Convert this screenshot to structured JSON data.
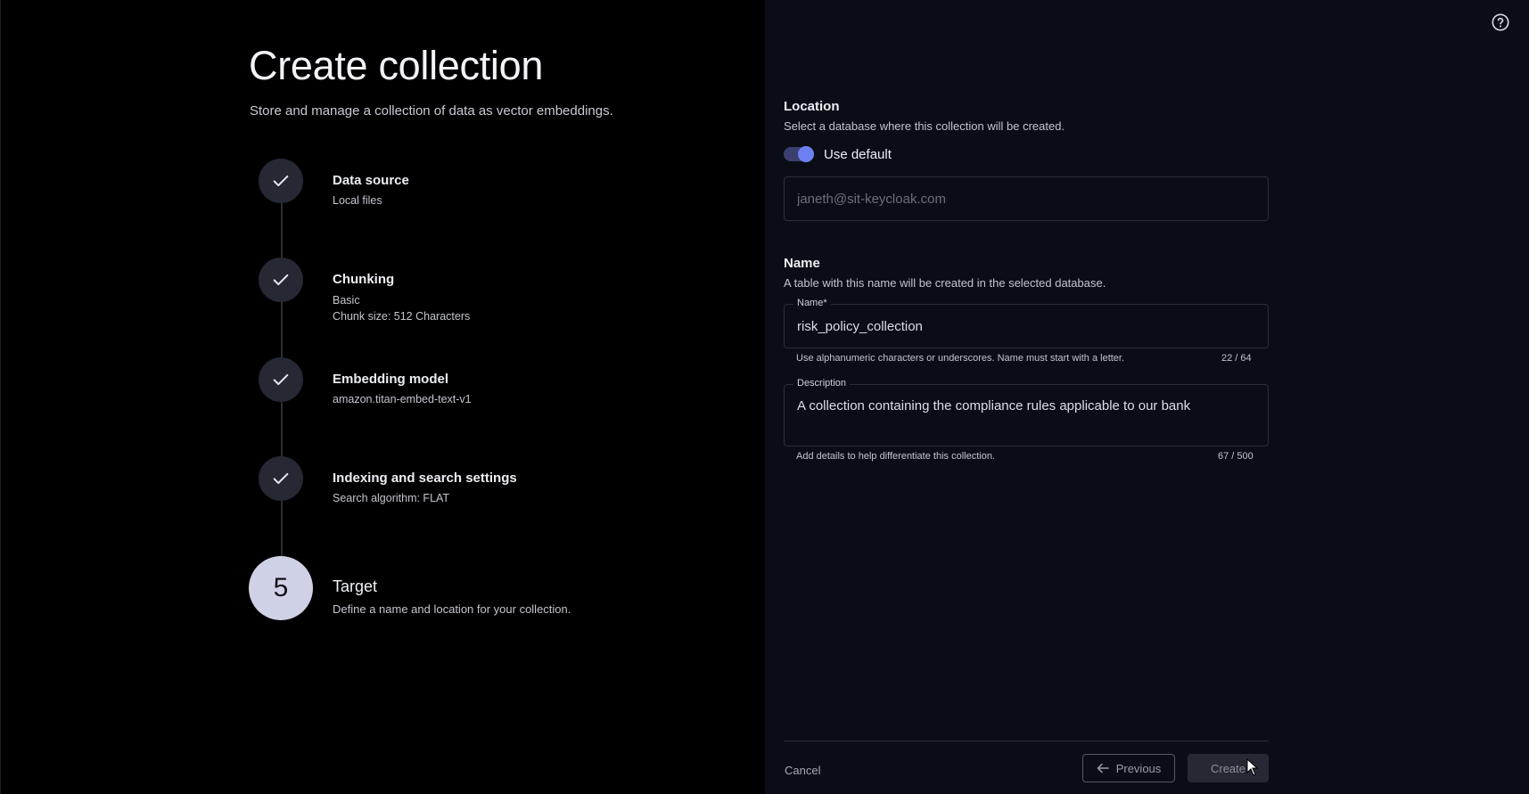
{
  "header": {
    "title": "Create collection",
    "subtitle": "Store and manage a collection of data as vector embeddings."
  },
  "steps": [
    {
      "title": "Data source",
      "lines": [
        "Local files"
      ],
      "status": "complete"
    },
    {
      "title": "Chunking",
      "lines": [
        "Basic",
        "Chunk size: 512 Characters"
      ],
      "status": "complete"
    },
    {
      "title": "Embedding model",
      "lines": [
        "amazon.titan-embed-text-v1"
      ],
      "status": "complete"
    },
    {
      "title": "Indexing and search settings",
      "lines": [
        "Search algorithm: FLAT"
      ],
      "status": "complete"
    }
  ],
  "active_step": {
    "number": "5",
    "title": "Target",
    "description": "Define a name and location for your collection."
  },
  "location": {
    "title": "Location",
    "description": "Select a database where this collection will be created.",
    "toggle_label": "Use default",
    "toggle_on": true,
    "database_value": "janeth@sit-keycloak.com"
  },
  "name_section": {
    "title": "Name",
    "description": "A table with this name will be created in the selected database.",
    "name_label": "Name*",
    "name_value": "risk_policy_collection",
    "name_helper": "Use alphanumeric characters or underscores. Name must start with a letter.",
    "name_count": "22 / 64",
    "description_label": "Description",
    "description_value": "A collection containing the compliance rules applicable to our bank",
    "description_helper": "Add details to help differentiate this collection.",
    "description_count": "67 / 500"
  },
  "footer": {
    "cancel_label": "Cancel",
    "previous_label": "Previous",
    "create_label": "Create"
  },
  "colors": {
    "accent": "#6d80f2",
    "active_step": "#cfd1e6",
    "panel_right": "#0b0d16"
  }
}
